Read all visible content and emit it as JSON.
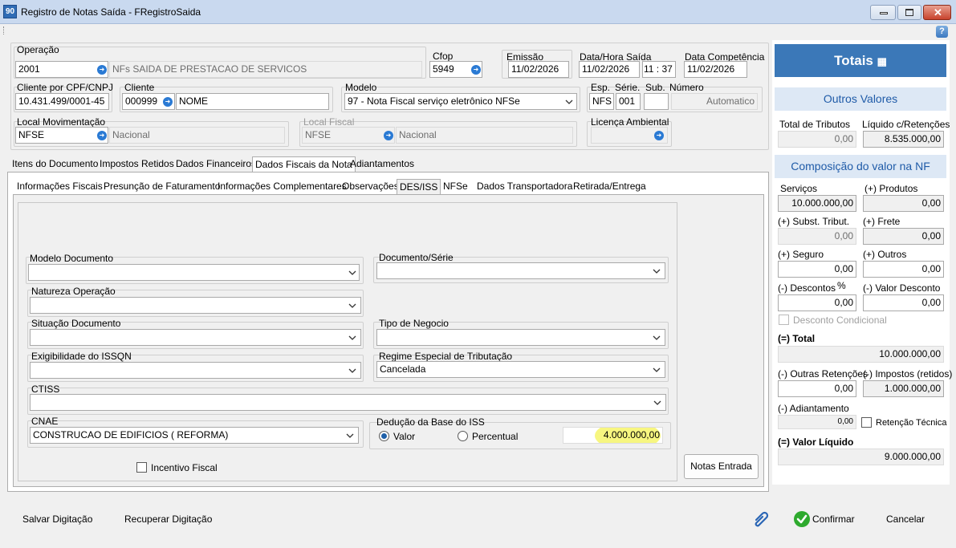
{
  "window": {
    "app_icon": "90",
    "title": "Registro de Notas Saída - FRegistroSaida"
  },
  "header": {
    "operacao": {
      "label": "Operação",
      "code": "2001",
      "description": "NFs SAIDA DE PRESTACAO DE SERVICOS"
    },
    "cfop": {
      "label": "Cfop",
      "value": "5949"
    },
    "emissao": {
      "label": "Emissão",
      "value": "11/02/2026"
    },
    "data_hora_saida": {
      "label": "Data/Hora Saída",
      "date": "11/02/2026",
      "hour": "11",
      "minute": "37"
    },
    "data_competencia": {
      "label": "Data Competência",
      "value": "11/02/2026"
    },
    "cliente_cpf": {
      "label": "Cliente por CPF/CNPJ",
      "value": "10.431.499/0001-45"
    },
    "cliente": {
      "label": "Cliente",
      "code": "000999",
      "name": "NOME"
    },
    "modelo": {
      "label": "Modelo",
      "value": "97 - Nota Fiscal serviço eletrônico NFSe"
    },
    "esp": {
      "label": "Esp.",
      "value": "NFS"
    },
    "serie": {
      "label": "Série.",
      "value": "001"
    },
    "sub": {
      "label": "Sub.",
      "value": ""
    },
    "numero": {
      "label": "Número",
      "value": "Automatico"
    },
    "local_movimentacao": {
      "label": "Local Movimentação",
      "code": "NFSE",
      "description": "Nacional"
    },
    "local_fiscal": {
      "label": "Local Fiscal",
      "code": "NFSE",
      "description": "Nacional"
    },
    "licenca_ambiental": {
      "label": "Licença Ambiental",
      "value": ""
    }
  },
  "main_tabs": [
    "Itens do Documento",
    "Impostos Retidos",
    "Dados Financeiros",
    "Dados Fiscais da Nota",
    "Adiantamentos"
  ],
  "main_tab_active": "Dados Fiscais da Nota",
  "sub_tabs": [
    "Informações Fiscais",
    "Presunção de Faturamento",
    "Informações Complementares",
    "Observações",
    "DES/ISS",
    "NFSe",
    "Dados Transportadora",
    "Retirada/Entrega"
  ],
  "sub_tab_active": "DES/ISS",
  "des_iss": {
    "modelo_documento": {
      "label": "Modelo Documento",
      "value": ""
    },
    "documento_serie": {
      "label": "Documento/Série",
      "value": ""
    },
    "natureza_operacao": {
      "label": "Natureza Operação",
      "value": ""
    },
    "situacao_documento": {
      "label": "Situação Documento",
      "value": ""
    },
    "tipo_negocio": {
      "label": "Tipo de Negocio",
      "value": ""
    },
    "exigibilidade": {
      "label": "Exigibilidade do ISSQN",
      "value": ""
    },
    "regime_especial": {
      "label": "Regime Especial de Tributação",
      "value": "Cancelada"
    },
    "ctiss": {
      "label": "CTISS",
      "value": ""
    },
    "cnae": {
      "label": "CNAE",
      "value": "CONSTRUCAO DE EDIFICIOS ( REFORMA)"
    },
    "deducao": {
      "label": "Dedução da Base do ISS",
      "opt_valor": "Valor",
      "opt_percentual": "Percentual",
      "selected": "Valor",
      "value": "4.000.000,00",
      "highlight_color": "#f6f46a"
    },
    "incentivo_fiscal": {
      "label": "Incentivo Fiscal",
      "checked": false
    },
    "notas_entrada_button": "Notas Entrada"
  },
  "totais": {
    "title": "Totais",
    "outros_valores_header": "Outros Valores",
    "total_tributos": {
      "label": "Total de Tributos",
      "value": "0,00"
    },
    "liquido_retencoes": {
      "label": "Líquido c/Retenções",
      "value": "8.535.000,00"
    },
    "composicao_header": "Composição do valor na NF",
    "servicos": {
      "label": "Serviços",
      "value": "10.000.000,00"
    },
    "produtos": {
      "label": "(+) Produtos",
      "value": "0,00"
    },
    "subst_tribut": {
      "label": "(+) Subst. Tribut.",
      "value": "0,00"
    },
    "frete": {
      "label": "(+) Frete",
      "value": "0,00"
    },
    "seguro": {
      "label": "(+) Seguro",
      "value": "0,00"
    },
    "outros": {
      "label": "(+) Outros",
      "value": "0,00"
    },
    "descontos": {
      "label": "(-) Descontos",
      "pct": "%",
      "value": "0,00"
    },
    "valor_desconto": {
      "label": "(-) Valor Desconto",
      "value": "0,00"
    },
    "desconto_condicional": {
      "label": "Desconto Condicional",
      "checked": false
    },
    "total": {
      "label": "(=) Total",
      "value": "10.000.000,00"
    },
    "outras_retencoes": {
      "label": "(-) Outras Retenções",
      "value": "0,00"
    },
    "impostos_retidos": {
      "label": "(-) Impostos (retidos)",
      "value": "1.000.000,00"
    },
    "adiantamento": {
      "label": "(-) Adiantamento",
      "value": "0,00"
    },
    "retencao_tecnica": {
      "label": "Retenção Técnica",
      "checked": false
    },
    "valor_liquido": {
      "label": "(=) Valor Líquido",
      "value": "9.000.000,00"
    }
  },
  "footer": {
    "salvar": "Salvar Digitação",
    "recuperar": "Recuperar Digitação",
    "confirmar": "Confirmar",
    "cancelar": "Cancelar"
  },
  "colors": {
    "accent": "#3b78b8",
    "header_blue": "#1f5ba8",
    "highlight": "#f6f46a",
    "confirm_green": "#2eaa2e"
  }
}
